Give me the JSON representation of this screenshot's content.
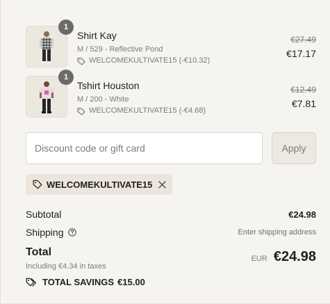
{
  "line_items": [
    {
      "quantity": "1",
      "title": "Shirt Kay",
      "variant": "M / 529 - Reflective Pond",
      "discount": "WELCOMEKULTIVATE15 (-€10.32)",
      "original_price": "€27.49",
      "final_price": "€17.17",
      "thumb_icon": "product-photo-shirt"
    },
    {
      "quantity": "1",
      "title": "Tshirt Houston",
      "variant": "M / 200 - White",
      "discount": "WELCOMEKULTIVATE15 (-€4.68)",
      "original_price": "€12.49",
      "final_price": "€7.81",
      "thumb_icon": "product-photo-tshirt"
    }
  ],
  "discount_form": {
    "placeholder": "Discount code or gift card",
    "value": "",
    "apply_label": "Apply"
  },
  "applied_code": {
    "code": "WELCOMEKULTIVATE15"
  },
  "summary": {
    "subtotal_label": "Subtotal",
    "subtotal_value": "€24.98",
    "shipping_label": "Shipping",
    "shipping_value": "Enter shipping address",
    "total_label": "Total",
    "tax_note": "Including €4.34 in taxes",
    "currency": "EUR",
    "total_value": "€24.98",
    "savings_label": "TOTAL SAVINGS",
    "savings_value": "€15.00"
  },
  "colors": {
    "background": "#f6f4f1",
    "badge": "#6b6b6b",
    "chip": "#ebe5dc",
    "apply_button": "#ede8e0"
  }
}
